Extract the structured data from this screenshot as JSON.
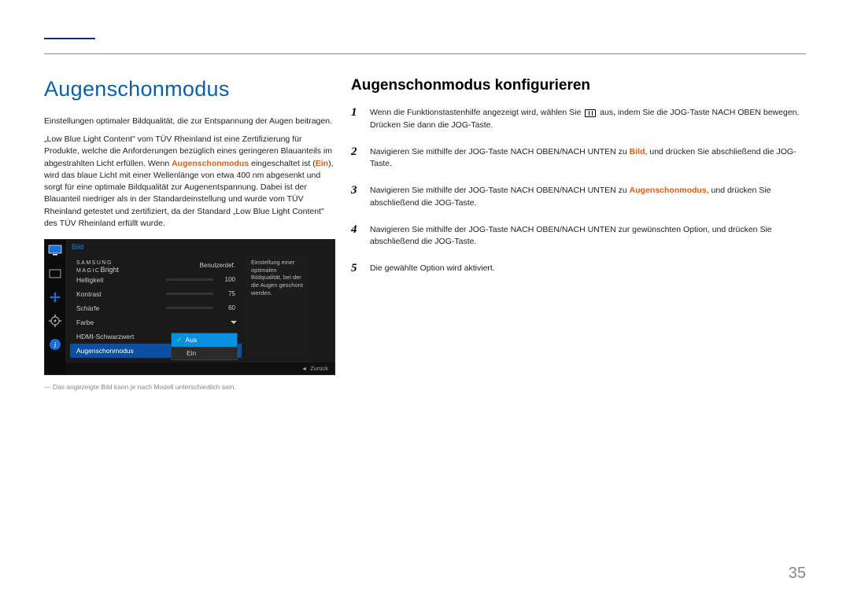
{
  "page_number": "35",
  "left": {
    "title": "Augenschonmodus",
    "para1": "Einstellungen optimaler Bildqualität, die zur Entspannung der Augen beitragen.",
    "para2_a": "„Low Blue Light Content\" vom TÜV Rheinland ist eine Zertifizierung für Produkte, welche die Anforderungen bezüglich eines geringeren Blauanteils im abgestrahlten Licht erfüllen. Wenn ",
    "para2_b": "Augenschonmodus",
    "para2_c": " eingeschaltet ist (",
    "para2_d": "Ein",
    "para2_e": "), wird das blaue Licht mit einer Wellenlänge von etwa 400 nm abgesenkt und sorgt für eine optimale Bildqualität zur Augenentspannung. Dabei ist der Blauanteil niedriger als in der Standardeinstellung und wurde vom TÜV Rheinland getestet und zertifiziert, da der Standard „Low Blue Light Content\" des TÜV Rheinland erfüllt wurde.",
    "footnote": "Das angezeigte Bild kann je nach Modell unterschiedlich sein."
  },
  "ui": {
    "tab": "Bild",
    "magic": "SAMSUNG",
    "magic2": "MAGIC",
    "bright": "Bright",
    "bright_val": "Benutzerdef.",
    "rows": {
      "helligkeit": {
        "label": "Helligkeit",
        "val": "100",
        "pct": 100
      },
      "kontrast": {
        "label": "Kontrast",
        "val": "75",
        "pct": 75
      },
      "schaerfe": {
        "label": "Schärfe",
        "val": "60",
        "pct": 60
      },
      "farbe": {
        "label": "Farbe"
      },
      "hdmi": {
        "label": "HDMI-Schwarzwert"
      },
      "augen": {
        "label": "Augenschonmodus"
      }
    },
    "popup": {
      "aus": "Aus",
      "ein": "Ein"
    },
    "desc": "Einstellung einer optimalen Bildqualität, bei der die Augen geschont werden.",
    "back": "Zurück"
  },
  "right": {
    "title": "Augenschonmodus konfigurieren",
    "steps": [
      {
        "n": "1",
        "pre": "Wenn die Funktionstastenhilfe angezeigt wird, wählen Sie ",
        "post": " aus, indem Sie die JOG-Taste NACH OBEN bewegen. Drücken Sie dann die JOG-Taste."
      },
      {
        "n": "2",
        "a": "Navigieren Sie mithilfe der JOG-Taste NACH OBEN/NACH UNTEN zu ",
        "b": "Bild",
        "c": ", und drücken Sie abschließend die JOG-Taste."
      },
      {
        "n": "3",
        "a": "Navigieren Sie mithilfe der JOG-Taste NACH OBEN/NACH UNTEN zu ",
        "b": "Augenschonmodus",
        "c": ", und drücken Sie abschließend die JOG-Taste."
      },
      {
        "n": "4",
        "a": "Navigieren Sie mithilfe der JOG-Taste NACH OBEN/NACH UNTEN zur gewünschten Option, und drücken Sie abschließend die JOG-Taste."
      },
      {
        "n": "5",
        "a": "Die gewählte Option wird aktiviert."
      }
    ]
  }
}
